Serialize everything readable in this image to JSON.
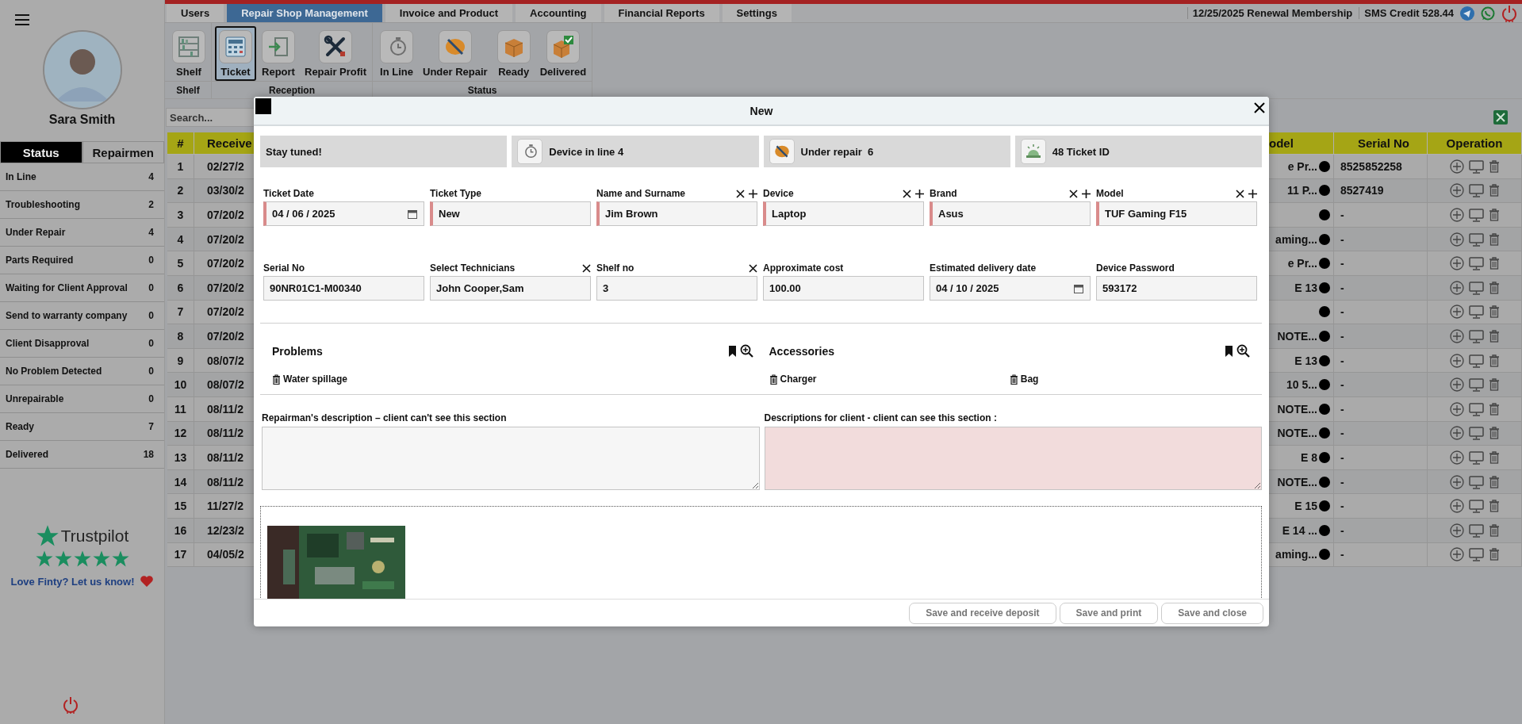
{
  "sidebar": {
    "user": {
      "name": "Sara Smith"
    },
    "tabs": [
      {
        "label": "Status",
        "selected": true
      },
      {
        "label": "Repairmen",
        "selected": false
      }
    ],
    "items": [
      {
        "label": "In Line",
        "count": "4"
      },
      {
        "label": "Troubleshooting",
        "count": "2"
      },
      {
        "label": "Under Repair",
        "count": "4"
      },
      {
        "label": "Parts Required",
        "count": "0"
      },
      {
        "label": "Waiting for Client Approval",
        "count": "0"
      },
      {
        "label": "Send to warranty company",
        "count": "0"
      },
      {
        "label": "Client Disapproval",
        "count": "0"
      },
      {
        "label": "No Problem Detected",
        "count": "0"
      },
      {
        "label": "Unrepairable",
        "count": "0"
      },
      {
        "label": "Ready",
        "count": "7"
      },
      {
        "label": "Delivered",
        "count": "18"
      }
    ],
    "trustpilot": {
      "brand": "Trustpilot",
      "stars": 5,
      "message": "Love Finty? Let us know!"
    }
  },
  "top_tabs": [
    {
      "label": "Users",
      "selected": false
    },
    {
      "label": "Repair Shop Management",
      "selected": true
    },
    {
      "label": "Invoice and Product",
      "selected": false
    },
    {
      "label": "Accounting",
      "selected": false
    },
    {
      "label": "Financial Reports",
      "selected": false
    },
    {
      "label": "Settings",
      "selected": false
    }
  ],
  "header_info": {
    "renewal": "12/25/2025 Renewal Membership",
    "sms_credit": "SMS Credit 528.44"
  },
  "toolbar": {
    "groups": [
      {
        "label": "Shelf",
        "buttons": [
          {
            "label": "Shelf",
            "kind": "shelf",
            "selected": false
          }
        ]
      },
      {
        "label": "Reception",
        "buttons": [
          {
            "label": "Ticket",
            "kind": "ticket",
            "selected": true
          },
          {
            "label": "Report",
            "kind": "report",
            "selected": false
          },
          {
            "label": "Repair Profit",
            "kind": "profit",
            "selected": false
          }
        ]
      },
      {
        "label": "Status",
        "buttons": [
          {
            "label": "In Line",
            "kind": "inline",
            "selected": false
          },
          {
            "label": "Under Repair",
            "kind": "repair",
            "selected": false
          },
          {
            "label": "Ready",
            "kind": "ready",
            "selected": false
          },
          {
            "label": "Delivered",
            "kind": "delivered",
            "selected": false
          }
        ]
      }
    ]
  },
  "search": {
    "placeholder": "Search..."
  },
  "table": {
    "columns": [
      "#",
      "Receive",
      "odel",
      "Serial No",
      "Operation"
    ],
    "rows": [
      {
        "number": "1",
        "received": "02/27/2",
        "model": "e Pr...",
        "serial": "8525852258"
      },
      {
        "number": "2",
        "received": "03/30/2",
        "model": "11 P...",
        "serial": "8527419"
      },
      {
        "number": "3",
        "received": "07/20/2",
        "model": "",
        "serial": "-"
      },
      {
        "number": "4",
        "received": "07/20/2",
        "model": "aming...",
        "serial": "-"
      },
      {
        "number": "5",
        "received": "07/20/2",
        "model": "e Pr...",
        "serial": "-"
      },
      {
        "number": "6",
        "received": "07/20/2",
        "model": "E 13",
        "serial": "-"
      },
      {
        "number": "7",
        "received": "07/20/2",
        "model": "",
        "serial": "-"
      },
      {
        "number": "8",
        "received": "07/20/2",
        "model": "NOTE...",
        "serial": "-"
      },
      {
        "number": "9",
        "received": "08/07/2",
        "model": "E 13",
        "serial": "-"
      },
      {
        "number": "10",
        "received": "08/07/2",
        "model": "10 5...",
        "serial": "-"
      },
      {
        "number": "11",
        "received": "08/11/2",
        "model": "NOTE...",
        "serial": "-"
      },
      {
        "number": "12",
        "received": "08/11/2",
        "model": "NOTE...",
        "serial": "-"
      },
      {
        "number": "13",
        "received": "08/11/2",
        "model": "E 8",
        "serial": "-"
      },
      {
        "number": "14",
        "received": "08/11/2",
        "model": "NOTE...",
        "serial": "-"
      },
      {
        "number": "15",
        "received": "11/27/2",
        "model": "E 15",
        "serial": "-"
      },
      {
        "number": "16",
        "received": "12/23/2",
        "model": "E 14 ...",
        "serial": "-"
      },
      {
        "number": "17",
        "received": "04/05/2",
        "model": "aming...",
        "serial": "-"
      }
    ]
  },
  "dialog": {
    "title": "New",
    "info_cards": [
      {
        "kind": "text",
        "text": "Stay tuned!"
      },
      {
        "kind": "inline",
        "text": "Device in line 4"
      },
      {
        "kind": "repair",
        "text": "Under repair  6"
      },
      {
        "kind": "bell",
        "text": "48 Ticket ID"
      }
    ],
    "fields": [
      {
        "label": "Ticket Date",
        "value": "04 / 06 / 2025",
        "kind": "date",
        "required": true,
        "clearable": false,
        "addable": false
      },
      {
        "label": "Ticket Type",
        "value": "New",
        "kind": "text",
        "required": true,
        "clearable": false,
        "addable": false
      },
      {
        "label": "Name and Surname",
        "value": "Jim Brown",
        "kind": "text",
        "required": true,
        "clearable": true,
        "addable": true
      },
      {
        "label": "Device",
        "value": "Laptop",
        "kind": "text",
        "required": true,
        "clearable": true,
        "addable": true
      },
      {
        "label": "Brand",
        "value": "Asus",
        "kind": "text",
        "required": true,
        "clearable": true,
        "addable": true
      },
      {
        "label": "Model",
        "value": "TUF Gaming F15",
        "kind": "text",
        "required": true,
        "clearable": true,
        "addable": true
      },
      {
        "label": "Serial No",
        "value": "90NR01C1-M00340",
        "kind": "text",
        "required": false,
        "clearable": false,
        "addable": false
      },
      {
        "label": "Select Technicians",
        "value": "John Cooper,Sam",
        "kind": "text",
        "required": false,
        "clearable": true,
        "addable": false
      },
      {
        "label": "Shelf no",
        "value": "3",
        "kind": "text",
        "required": false,
        "clearable": true,
        "addable": false
      },
      {
        "label": "Approximate cost",
        "value": "100.00",
        "kind": "text",
        "required": false,
        "clearable": false,
        "addable": false
      },
      {
        "label": "Estimated delivery date",
        "value": "04 / 10 / 2025",
        "kind": "date",
        "required": false,
        "clearable": false,
        "addable": false
      },
      {
        "label": "Device Password",
        "value": "593172",
        "kind": "text",
        "required": false,
        "clearable": false,
        "addable": false
      }
    ],
    "problems": {
      "title": "Problems",
      "items": [
        "Water spillage"
      ]
    },
    "accessories": {
      "title": "Accessories",
      "items": [
        "Charger",
        "Bag"
      ]
    },
    "notes": [
      {
        "label": "Repairman's description – client can't see this section",
        "kind": "private"
      },
      {
        "label": "Descriptions for client - client can see this section :",
        "kind": "client"
      }
    ],
    "attachments": [
      {
        "kind": "picture"
      }
    ],
    "buttons": [
      "Save and receive deposit",
      "Save and print",
      "Save and close"
    ]
  }
}
